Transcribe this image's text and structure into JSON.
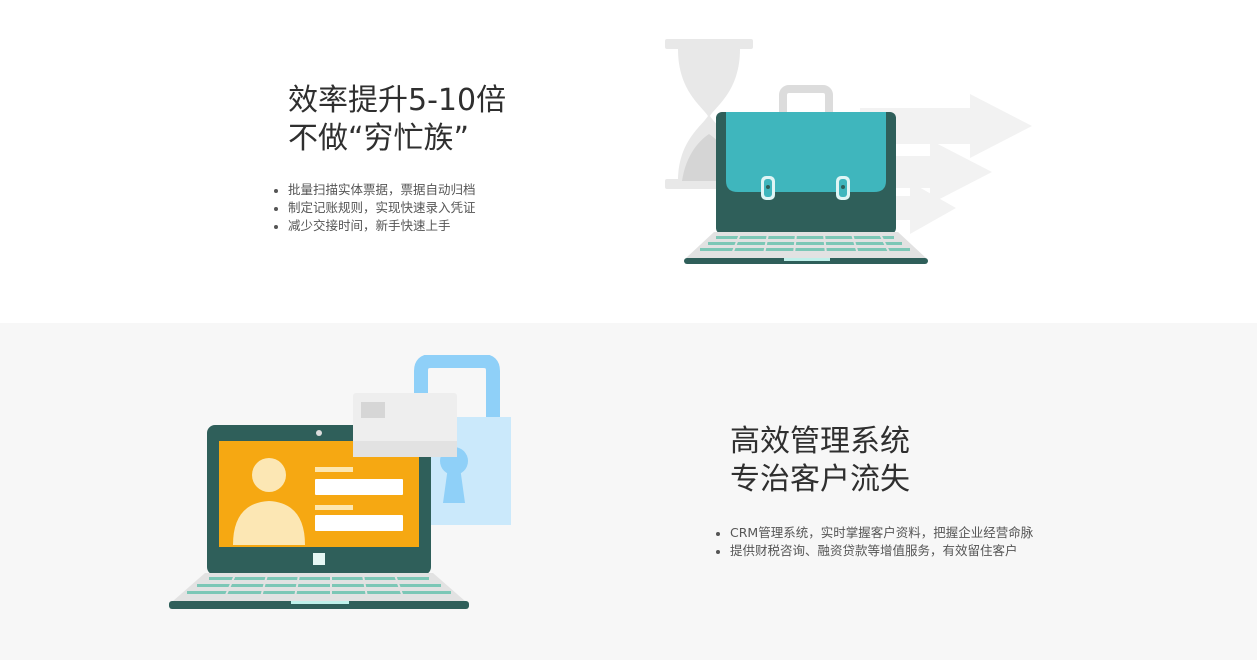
{
  "feature1": {
    "title_line1": "效率提升5-10倍",
    "title_line2": "不做“穷忙族”",
    "bullets": [
      "批量扫描实体票据，票据自动归档",
      "制定记账规则，实现快速录入凭证",
      "减少交接时间，新手快速上手"
    ],
    "illustration": "laptop-briefcase-hourglass-icon"
  },
  "feature2": {
    "title_line1": "高效管理系统",
    "title_line2": "专治客户流失",
    "bullets": [
      "CRM管理系统，实时掌握客户资料，把握企业经营命脉",
      "提供财税咨询、融资贷款等增值服务，有效留住客户"
    ],
    "illustration": "laptop-profile-lock-icon"
  },
  "colors": {
    "section2_bg": "#f7f7f7",
    "briefcase_teal": "#3fb6bd",
    "laptop_dark": "#2f5f5a",
    "screen_orange": "#f6a812",
    "lock_blue": "#8fd0f8"
  }
}
